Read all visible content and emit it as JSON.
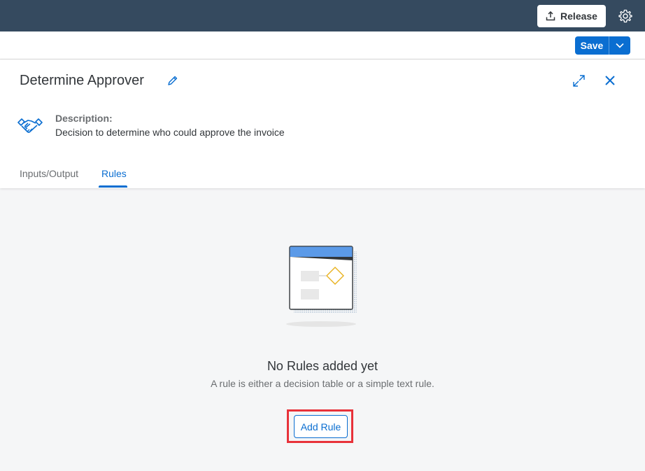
{
  "shellbar": {
    "release_label": "Release",
    "release_icon": "upload-icon",
    "settings_icon": "gear-icon",
    "background": "#354a5f"
  },
  "toolbar": {
    "save_label": "Save",
    "save_menu_icon": "chevron-down-icon",
    "accent": "#0a6ed1"
  },
  "header": {
    "title": "Determine Approver",
    "edit_icon": "pencil-icon",
    "expand_icon": "expand-icon",
    "close_icon": "close-icon",
    "object_icon": "handshake-icon",
    "description_label": "Description:",
    "description_text": "Decision to determine who could approve the invoice"
  },
  "tabs": [
    {
      "label": "Inputs/Output",
      "selected": false
    },
    {
      "label": "Rules",
      "selected": true
    }
  ],
  "empty_state": {
    "illustration": "empty-rules-illustration",
    "title": "No Rules added yet",
    "subtitle": "A rule is either a decision table or a simple text rule.",
    "button_label": "Add Rule",
    "highlight_color": "#e8323a"
  }
}
